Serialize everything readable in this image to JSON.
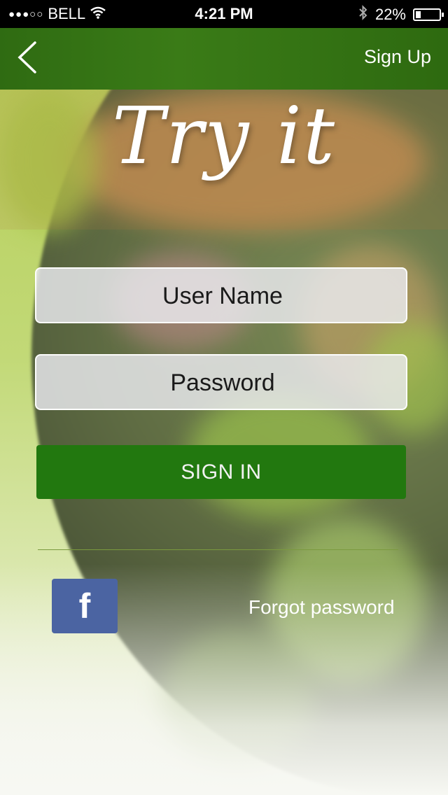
{
  "status_bar": {
    "signal_dots": "●●●○○",
    "carrier": "BELL",
    "time": "4:21 PM",
    "battery_percent": "22%",
    "battery_level": 0.22
  },
  "nav": {
    "back_icon": "chevron-left-icon",
    "signup_label": "Sign Up"
  },
  "hero": {
    "title": "Try it"
  },
  "form": {
    "username_placeholder": "User Name",
    "password_placeholder": "Password",
    "username_value": "",
    "password_value": "",
    "signin_label": "SIGN IN"
  },
  "footer": {
    "facebook_glyph": "f",
    "forgot_label": "Forgot password"
  },
  "colors": {
    "navbar": "#3a7b17",
    "signin_button": "#22780f",
    "facebook": "#4b64a2"
  }
}
